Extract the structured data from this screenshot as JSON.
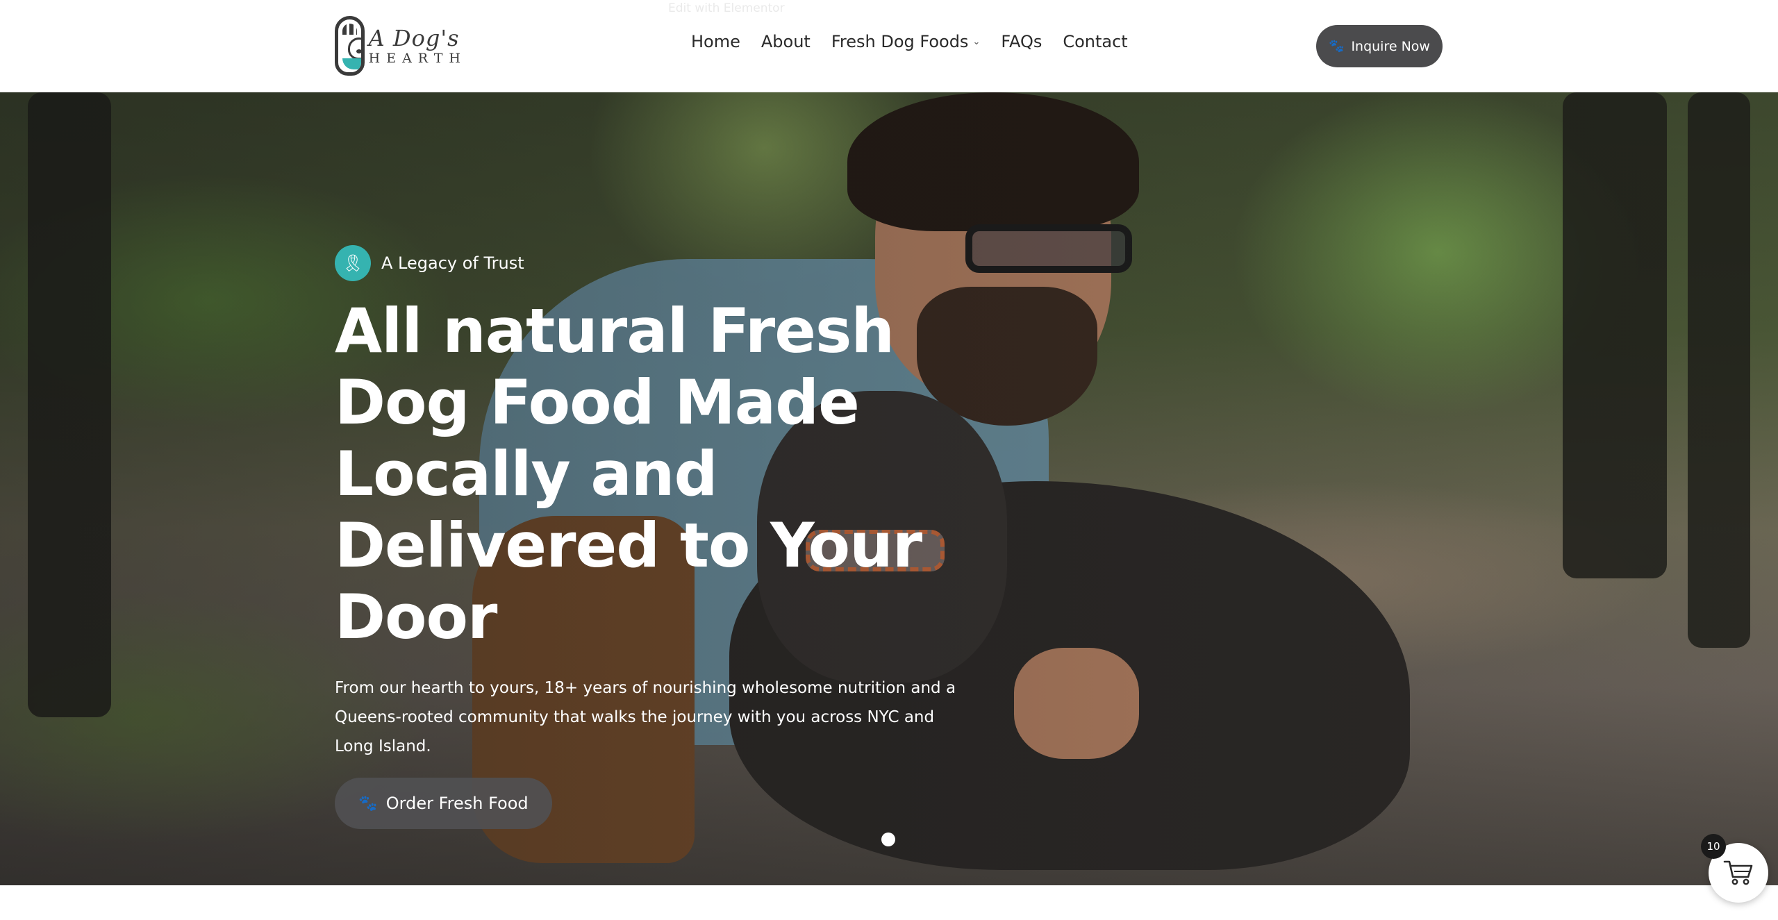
{
  "header": {
    "made_with": "Edit with Elementor",
    "logo": {
      "top_text": "A Dog's",
      "bottom_text": "HEARTH"
    },
    "nav": [
      {
        "label": "Home"
      },
      {
        "label": "About"
      },
      {
        "label": "Fresh Dog Foods",
        "has_dropdown": true
      },
      {
        "label": "FAQs"
      },
      {
        "label": "Contact"
      }
    ],
    "cta_label": "Inquire Now"
  },
  "hero": {
    "eyebrow": "A Legacy of Trust",
    "headline": "All natural Fresh Dog Food Made Locally and Delivered to Your Door",
    "subtext": "From our hearth to yours, 18+ years of nourishing wholesome nutrition and a Queens-rooted community that walks the journey with you across NYC and Long Island.",
    "button_label": "Order Fresh Food",
    "slide_index": 1,
    "slide_count": 1
  },
  "cart": {
    "count": "10"
  },
  "colors": {
    "accent_teal": "#35b3b0",
    "button_dark": "#4b4b4d",
    "text_dark": "#2a2a2a"
  },
  "icons": {
    "eyebrow": "award-ribbon-icon",
    "cta": "paw-icon",
    "cart": "shopping-cart-icon"
  }
}
